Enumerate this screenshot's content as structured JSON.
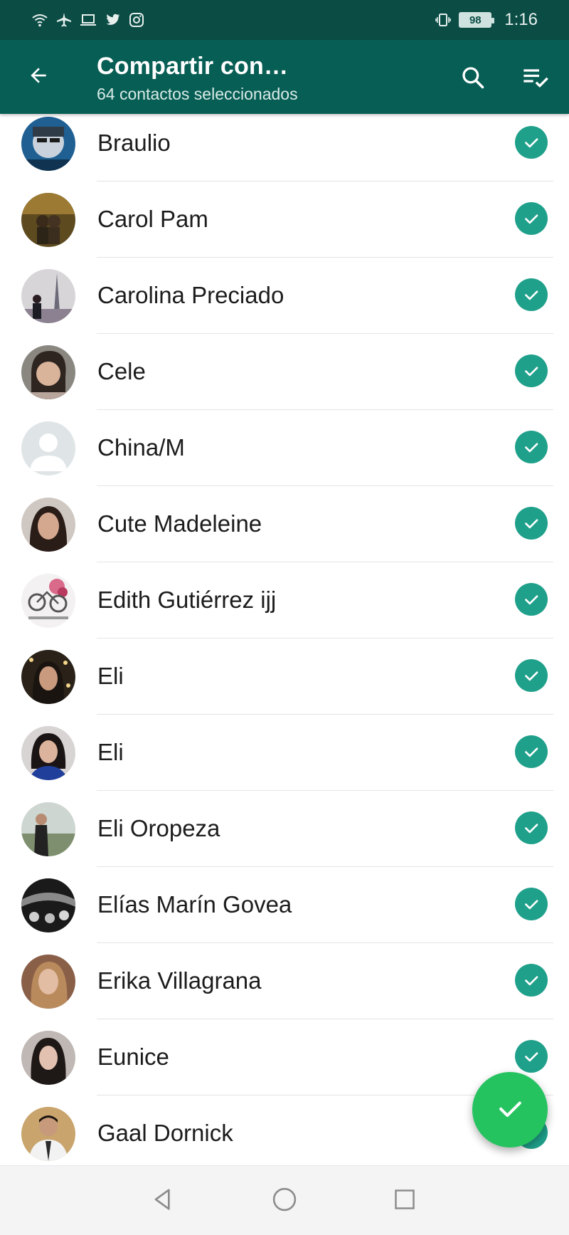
{
  "status_bar": {
    "time": "1:16",
    "battery": "98",
    "left_icons": [
      "wifi-icon",
      "airplane-icon",
      "laptop-icon",
      "twitter-icon",
      "instagram-icon"
    ],
    "right_icons": [
      "vibrate-icon",
      "battery-icon"
    ]
  },
  "app_bar": {
    "title": "Compartir con…",
    "subtitle": "64 contactos seleccionados",
    "back_icon": "arrow-left-icon",
    "search_icon": "search-icon",
    "select_all_icon": "select-all-icon"
  },
  "contacts": [
    {
      "name": "Braulio",
      "selected": true
    },
    {
      "name": "Carol Pam",
      "selected": true
    },
    {
      "name": "Carolina Preciado",
      "selected": true
    },
    {
      "name": "Cele",
      "selected": true
    },
    {
      "name": "China/M",
      "selected": true
    },
    {
      "name": "Cute Madeleine",
      "selected": true
    },
    {
      "name": "Edith Gutiérrez ijj",
      "selected": true
    },
    {
      "name": "Eli",
      "selected": true
    },
    {
      "name": "Eli",
      "selected": true
    },
    {
      "name": "Eli Oropeza",
      "selected": true
    },
    {
      "name": "Elías Marín Govea",
      "selected": true
    },
    {
      "name": "Erika Villagrana",
      "selected": true
    },
    {
      "name": "Eunice",
      "selected": true
    },
    {
      "name": "Gaal Dornick",
      "selected": true
    }
  ],
  "fab": {
    "icon": "check-icon"
  },
  "nav_bar": {
    "icons": [
      "nav-back-icon",
      "nav-home-icon",
      "nav-recent-icon"
    ]
  },
  "colors": {
    "status_bar": "#0b4d45",
    "app_bar": "#075e54",
    "check": "#1fa08a",
    "fab": "#25c360"
  }
}
